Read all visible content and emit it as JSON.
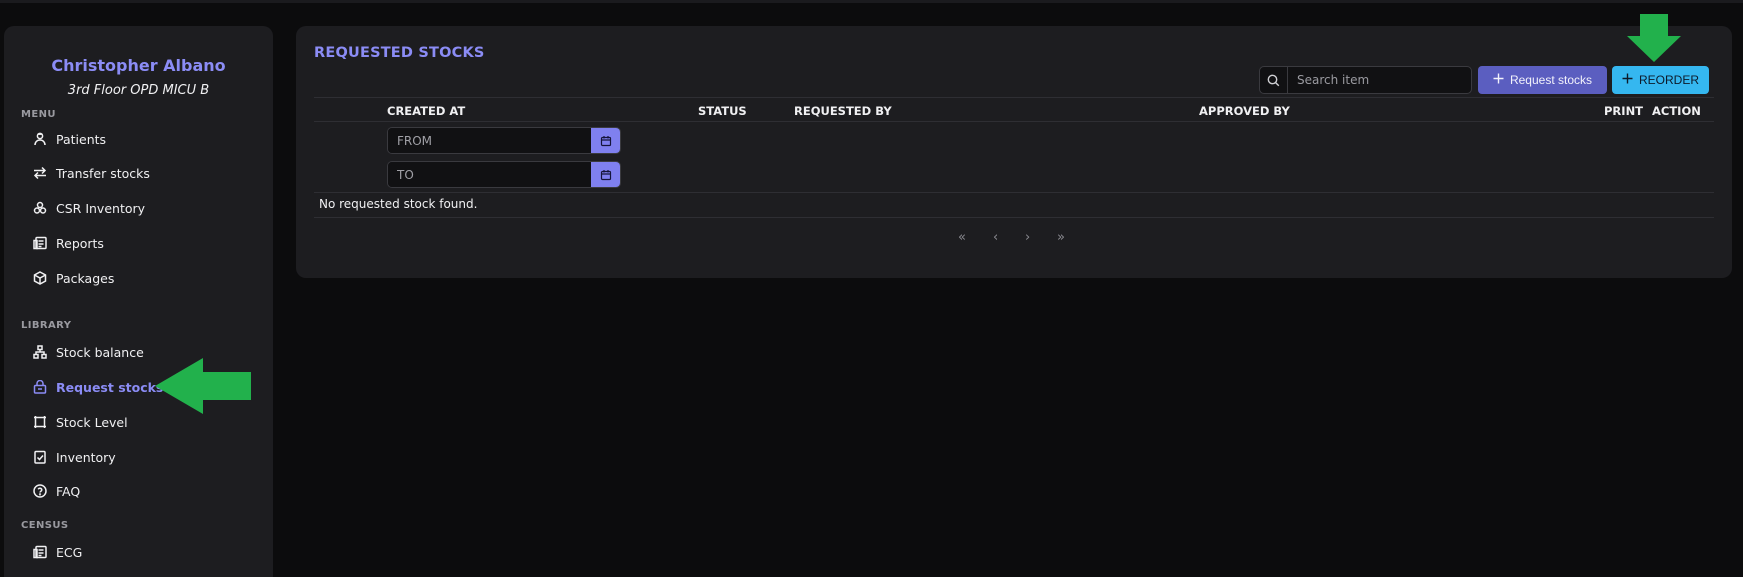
{
  "user": {
    "name": "Christopher Albano",
    "location": "3rd Floor OPD MICU B"
  },
  "sidebar": {
    "sections": [
      {
        "label": "MENU",
        "items": [
          {
            "label": "Patients",
            "icon": "patient-icon"
          },
          {
            "label": "Transfer stocks",
            "icon": "transfer-arrows-icon"
          },
          {
            "label": "CSR Inventory",
            "icon": "cubes-icon"
          },
          {
            "label": "Reports",
            "icon": "report-icon"
          },
          {
            "label": "Packages",
            "icon": "package-icon"
          }
        ]
      },
      {
        "label": "LIBRARY",
        "items": [
          {
            "label": "Stock balance",
            "icon": "hierarchy-icon"
          },
          {
            "label": "Request stocks",
            "icon": "lock-box-icon",
            "active": true
          },
          {
            "label": "Stock Level",
            "icon": "frame-icon"
          },
          {
            "label": "Inventory",
            "icon": "clipboard-check-icon"
          },
          {
            "label": "FAQ",
            "icon": "help-circle-icon"
          }
        ]
      },
      {
        "label": "CENSUS",
        "items": [
          {
            "label": "ECG",
            "icon": "report-icon"
          }
        ]
      }
    ]
  },
  "main": {
    "title": "REQUESTED STOCKS",
    "search": {
      "placeholder": "Search item",
      "value": ""
    },
    "request_button": "Request stocks",
    "reorder_button": "REORDER",
    "columns": {
      "created_at": "CREATED AT",
      "status": "STATUS",
      "requested_by": "REQUESTED BY",
      "approved_by": "APPROVED BY",
      "print": "PRINT",
      "action": "ACTION"
    },
    "filters": {
      "from_placeholder": "FROM",
      "to_placeholder": "TO"
    },
    "empty_message": "No requested stock found.",
    "pagination": {
      "first": "«",
      "prev": "‹",
      "next": "›",
      "last": "»"
    }
  },
  "colors": {
    "accent": "#8b8cf5",
    "request_button": "#5b5ec0",
    "reorder_button": "#35b7f0",
    "annotation_arrow": "#22b14c"
  }
}
